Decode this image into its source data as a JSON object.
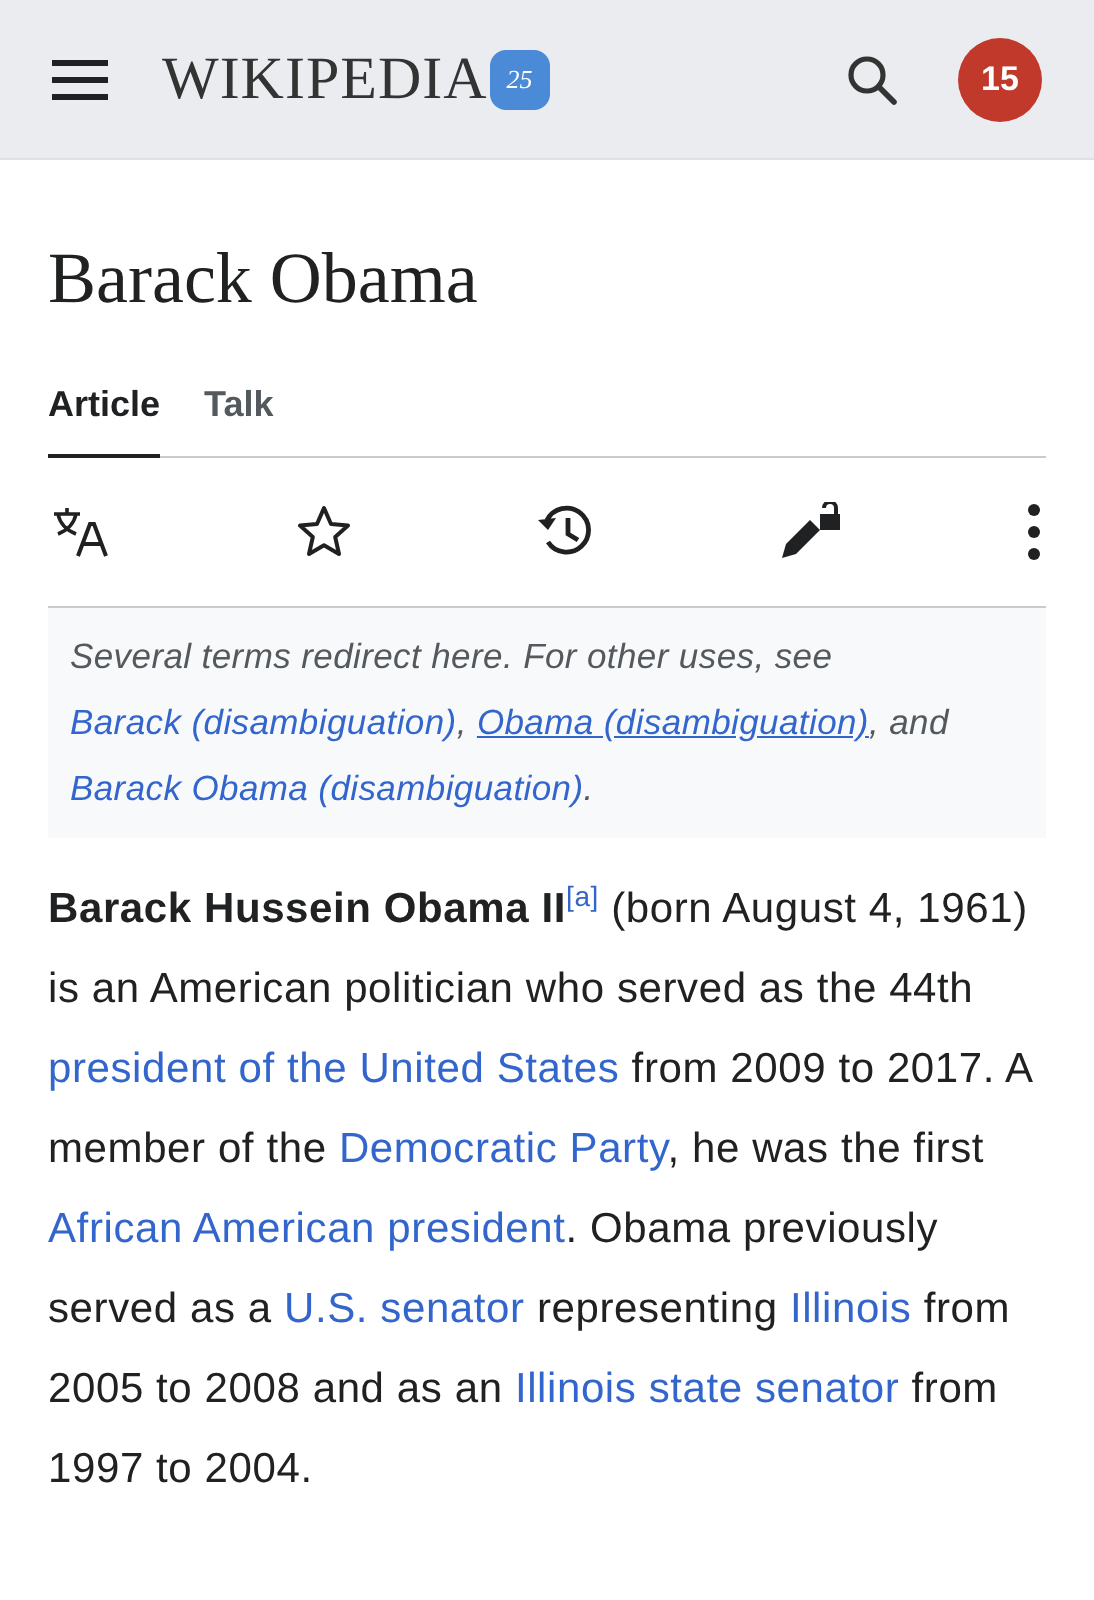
{
  "header": {
    "logo_text": "WIKIPEDIA",
    "logo_badge": "25",
    "notifications": "15"
  },
  "title": "Barack Obama",
  "tabs": [
    {
      "label": "Article",
      "selected": true
    },
    {
      "label": "Talk",
      "selected": false
    }
  ],
  "actions": [
    {
      "kind": "language"
    },
    {
      "kind": "watch"
    },
    {
      "kind": "history"
    },
    {
      "kind": "edit-locked"
    },
    {
      "kind": "more"
    }
  ],
  "hatnote": [
    {
      "kind": "text",
      "text": "Several terms redirect here. For other uses, see "
    },
    {
      "kind": "link",
      "text": "Barack (disambiguation)",
      "underlined": false
    },
    {
      "kind": "text",
      "text": ", "
    },
    {
      "kind": "link",
      "text": "Obama (disambiguation)",
      "underlined": true
    },
    {
      "kind": "text",
      "text": ", and "
    },
    {
      "kind": "link",
      "text": "Barack Obama (disambiguation)",
      "underlined": false
    },
    {
      "kind": "text",
      "text": "."
    }
  ],
  "paragraph": [
    {
      "kind": "bold",
      "text": "Barack Hussein Obama II"
    },
    {
      "kind": "sup",
      "text": "[a]"
    },
    {
      "kind": "text",
      "text": " (born August 4, 1961) is an American politician who served as the 44th "
    },
    {
      "kind": "link",
      "text": "president of the United States"
    },
    {
      "kind": "text",
      "text": " from 2009 to 2017. A member of the "
    },
    {
      "kind": "link",
      "text": "Democratic Party"
    },
    {
      "kind": "text",
      "text": ", he was the first "
    },
    {
      "kind": "link",
      "text": "African American"
    },
    {
      "kind": "space"
    },
    {
      "kind": "link",
      "text": "president"
    },
    {
      "kind": "text",
      "text": ". Obama previously served as a "
    },
    {
      "kind": "link",
      "text": "U.S. senator"
    },
    {
      "kind": "text",
      "text": " representing "
    },
    {
      "kind": "link",
      "text": "Illinois"
    },
    {
      "kind": "text",
      "text": " from 2005 to 2008 and as an "
    },
    {
      "kind": "link",
      "text": "Illinois state senator"
    },
    {
      "kind": "text",
      "text": " from 1997 to 2004."
    }
  ]
}
